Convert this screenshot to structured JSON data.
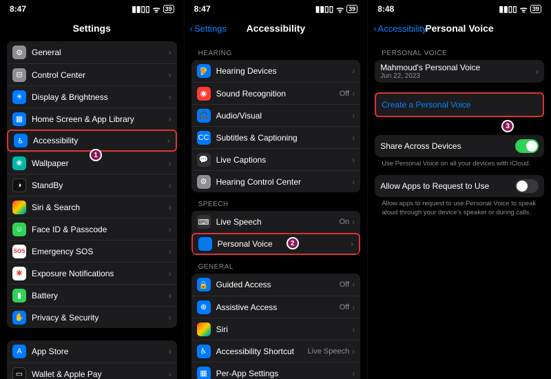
{
  "panel1": {
    "time": "8:47",
    "battery": "39",
    "title": "Settings",
    "groups": [
      {
        "items": [
          {
            "icon": "gear-icon",
            "color": "c-gray",
            "glyph": "⚙︎",
            "label": "General"
          },
          {
            "icon": "control-center-icon",
            "color": "c-gray",
            "glyph": "⊟",
            "label": "Control Center"
          },
          {
            "icon": "display-icon",
            "color": "c-blue",
            "glyph": "☀︎",
            "label": "Display & Brightness"
          },
          {
            "icon": "home-screen-icon",
            "color": "c-blue",
            "glyph": "▦",
            "label": "Home Screen & App Library"
          },
          {
            "icon": "accessibility-icon",
            "color": "c-blue",
            "glyph": "♿︎",
            "label": "Accessibility",
            "highlight": true
          },
          {
            "icon": "wallpaper-icon",
            "color": "c-teal",
            "glyph": "❀",
            "label": "Wallpaper"
          },
          {
            "icon": "standby-icon",
            "color": "c-black",
            "glyph": "◑",
            "label": "StandBy"
          },
          {
            "icon": "siri-icon",
            "color": "c-multicolor",
            "glyph": "",
            "label": "Siri & Search"
          },
          {
            "icon": "faceid-icon",
            "color": "c-green",
            "glyph": "☺︎",
            "label": "Face ID & Passcode"
          },
          {
            "icon": "sos-icon",
            "color": "c-redtxt",
            "glyph": "SOS",
            "label": "Emergency SOS"
          },
          {
            "icon": "exposure-icon",
            "color": "c-white",
            "glyph": "✱",
            "label": "Exposure Notifications"
          },
          {
            "icon": "battery-icon",
            "color": "c-green",
            "glyph": "▮",
            "label": "Battery"
          },
          {
            "icon": "privacy-icon",
            "color": "c-blue",
            "glyph": "✋",
            "label": "Privacy & Security"
          }
        ]
      },
      {
        "items": [
          {
            "icon": "appstore-icon",
            "color": "c-blue",
            "glyph": "A",
            "label": "App Store"
          },
          {
            "icon": "wallet-icon",
            "color": "c-black",
            "glyph": "▭",
            "label": "Wallet & Apple Pay"
          }
        ]
      }
    ],
    "badge1": "1"
  },
  "panel2": {
    "time": "8:47",
    "battery": "39",
    "back": "Settings",
    "title": "Accessibility",
    "sections": [
      {
        "header": "HEARING",
        "items": [
          {
            "icon": "hearing-devices-icon",
            "color": "c-blue",
            "glyph": "🦻",
            "label": "Hearing Devices"
          },
          {
            "icon": "sound-recognition-icon",
            "color": "c-red",
            "glyph": "◉",
            "label": "Sound Recognition",
            "value": "Off"
          },
          {
            "icon": "audio-visual-icon",
            "color": "c-blue",
            "glyph": "🎧",
            "label": "Audio/Visual"
          },
          {
            "icon": "subtitles-icon",
            "color": "c-blue",
            "glyph": "CC",
            "label": "Subtitles & Captioning"
          },
          {
            "icon": "live-captions-icon",
            "color": "c-dark",
            "glyph": "💬",
            "label": "Live Captions"
          },
          {
            "icon": "hearing-control-icon",
            "color": "c-gray",
            "glyph": "⚙︎",
            "label": "Hearing Control Center"
          }
        ]
      },
      {
        "header": "SPEECH",
        "items": [
          {
            "icon": "live-speech-icon",
            "color": "c-dark",
            "glyph": "⌨︎",
            "label": "Live Speech",
            "value": "On"
          },
          {
            "icon": "personal-voice-icon",
            "color": "c-blue",
            "glyph": "👤",
            "label": "Personal Voice",
            "highlight": true
          }
        ]
      },
      {
        "header": "GENERAL",
        "items": [
          {
            "icon": "guided-access-icon",
            "color": "c-blue",
            "glyph": "🔒",
            "label": "Guided Access",
            "value": "Off"
          },
          {
            "icon": "assistive-access-icon",
            "color": "c-blue",
            "glyph": "⊕",
            "label": "Assistive Access",
            "value": "Off"
          },
          {
            "icon": "siri-icon",
            "color": "c-multicolor",
            "glyph": "",
            "label": "Siri"
          },
          {
            "icon": "accessibility-shortcut-icon",
            "color": "c-blue",
            "glyph": "♿︎",
            "label": "Accessibility Shortcut",
            "value": "Live Speech"
          },
          {
            "icon": "per-app-icon",
            "color": "c-blue",
            "glyph": "▦",
            "label": "Per-App Settings"
          }
        ]
      }
    ],
    "badge2": "2"
  },
  "panel3": {
    "time": "8:48",
    "battery": "39",
    "back": "Accessibility",
    "title": "Personal Voice",
    "voice_header": "PERSONAL VOICE",
    "voice_name": "Mahmoud's Personal Voice",
    "voice_date": "Jun 22, 2023",
    "create_label": "Create a Personal Voice",
    "share_label": "Share Across Devices",
    "share_caption": "Use Personal Voice on all your devices with iCloud.",
    "allow_label": "Allow Apps to Request to Use",
    "allow_caption": "Allow apps to request to use Personal Voice to speak aloud through your device's speaker or during calls.",
    "badge3": "3"
  }
}
